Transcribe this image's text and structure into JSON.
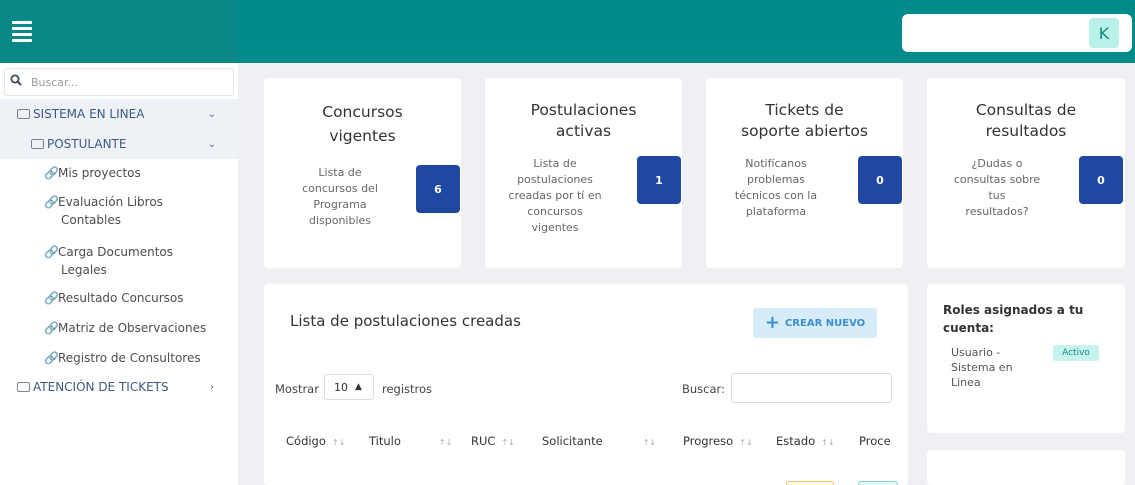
{
  "header": {
    "avatar_initial": "K"
  },
  "sidebar": {
    "search_placeholder": "Buscar...",
    "menu": [
      {
        "label": "SISTEMA EN LINEA"
      },
      {
        "label": "POSTULANTE"
      },
      {
        "label": "ATENCIÓN DE TICKETS"
      }
    ],
    "items": [
      {
        "label": "Mis proyectos"
      },
      {
        "label": "Evaluación Libros",
        "cont": "Contables"
      },
      {
        "label": "Carga Documentos",
        "cont": "Legales"
      },
      {
        "label": "Resultado Concursos"
      },
      {
        "label": "Matriz de Observaciones"
      },
      {
        "label": "Registro de Consultores"
      }
    ]
  },
  "cards": [
    {
      "title_1": "Concursos",
      "title_2": "vigentes",
      "desc": [
        "Lista de",
        "concursos del",
        "Programa",
        "disponibles"
      ],
      "count": "6"
    },
    {
      "title_1": "Postulaciones",
      "title_2": "activas",
      "desc": [
        "Lista de",
        "postulaciones",
        "creadas por tí en",
        "concursos",
        "vigentes"
      ],
      "count": "1"
    },
    {
      "title_1": "Tickets de",
      "title_2": "soporte abiertos",
      "desc": [
        "Notifícanos",
        "problemas",
        "técnicos con la",
        "plataforma"
      ],
      "count": "0"
    },
    {
      "title_1": "Consultas de",
      "title_2": "resultados",
      "desc": [
        "¿Dudas o",
        "consultas sobre",
        "tus",
        "resultados?"
      ],
      "count": "0"
    }
  ],
  "list": {
    "title": "Lista de postulaciones creadas",
    "create_label": "CREAR NUEVO",
    "show_label": "Mostrar",
    "length_value": "10",
    "records_label": "registros",
    "search_label": "Buscar:",
    "columns": [
      "Código",
      "Titulo",
      "RUC",
      "Solicitante",
      "Progreso",
      "Estado",
      "Proce"
    ]
  },
  "roles": {
    "title": "Roles asignados a tu cuenta:",
    "role_name": [
      "Usuario -",
      "Sistema en",
      "Linea"
    ],
    "role_status": "Activo"
  },
  "colors": {
    "header": "#008b8b",
    "badge": "#1f48a3",
    "active_badge_bg": "#c7f3ee"
  }
}
